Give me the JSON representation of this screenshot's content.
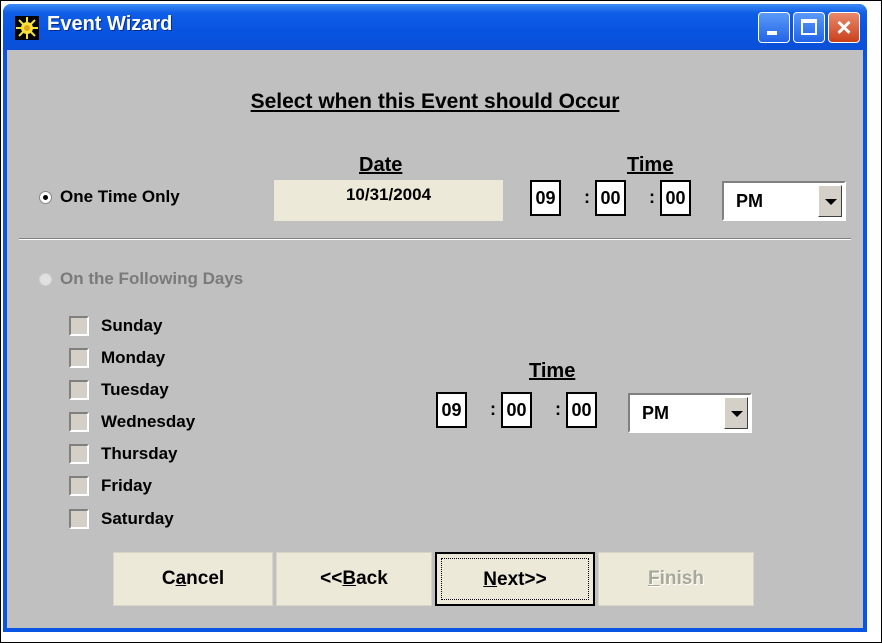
{
  "window": {
    "title": "Event Wizard",
    "icon": "sun-burst-icon",
    "controls": {
      "minimize": "minimize-icon",
      "maximize": "maximize-icon",
      "close": "close-icon"
    }
  },
  "heading": "Select when this Event should Occur",
  "one_time": {
    "label": "One Time Only",
    "selected": true,
    "date_label": "Date",
    "date_value": "10/31/2004",
    "time_label": "Time",
    "hour": "09",
    "minute": "00",
    "second": "00",
    "ampm": "PM"
  },
  "recurring": {
    "label": "On the Following Days",
    "selected": false,
    "enabled": false,
    "days": [
      {
        "label": "Sunday",
        "checked": false
      },
      {
        "label": "Monday",
        "checked": false
      },
      {
        "label": "Tuesday",
        "checked": false
      },
      {
        "label": "Wednesday",
        "checked": false
      },
      {
        "label": "Thursday",
        "checked": false
      },
      {
        "label": "Friday",
        "checked": false
      },
      {
        "label": "Saturday",
        "checked": false
      }
    ],
    "time_label": "Time",
    "hour": "09",
    "minute": "00",
    "second": "00",
    "ampm": "PM"
  },
  "buttons": {
    "cancel": {
      "pre": "C",
      "key": "a",
      "post": "ncel"
    },
    "back": {
      "pre": "<<",
      "key": "B",
      "post": "ack"
    },
    "next": {
      "pre": "",
      "key": "N",
      "post": "ext>>"
    },
    "finish": {
      "pre": "",
      "key": "F",
      "post": "inish",
      "enabled": false
    }
  },
  "colors": {
    "titlebar": "#0a54e3",
    "client": "#c0c0c0",
    "button_face": "#ece9d8"
  }
}
